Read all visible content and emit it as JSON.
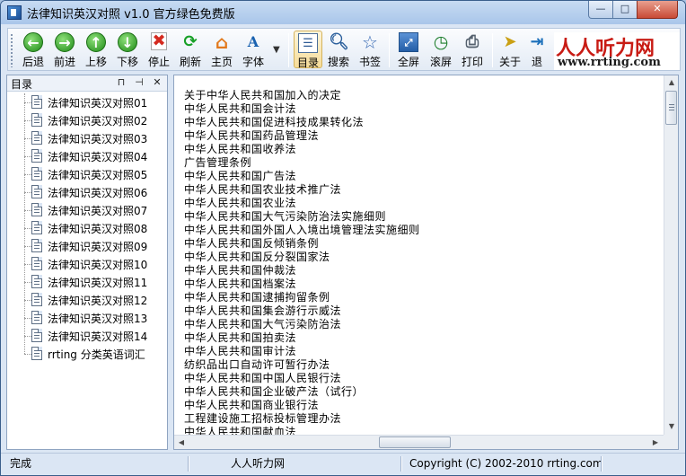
{
  "window": {
    "title": "法律知识英汉对照 v1.0 官方绿色免费版",
    "controls": {
      "minimize": "—",
      "maximize": "□",
      "close": "✕"
    }
  },
  "toolbar": {
    "buttons": [
      {
        "label": "后退",
        "icon": "back-arrow-icon",
        "glyph": "←"
      },
      {
        "label": "前进",
        "icon": "forward-arrow-icon",
        "glyph": "→"
      },
      {
        "label": "上移",
        "icon": "up-arrow-icon",
        "glyph": "↑"
      },
      {
        "label": "下移",
        "icon": "down-arrow-icon",
        "glyph": "↓"
      },
      {
        "label": "停止",
        "icon": "stop-icon",
        "glyph": "✖"
      },
      {
        "label": "刷新",
        "icon": "refresh-icon",
        "glyph": "⟳"
      },
      {
        "label": "主页",
        "icon": "home-icon",
        "glyph": "⌂"
      },
      {
        "label": "字体",
        "icon": "font-icon",
        "glyph": "A"
      },
      {
        "label": "目录",
        "icon": "directory-icon",
        "glyph": "☰"
      },
      {
        "label": "搜索",
        "icon": "search-icon",
        "glyph": "🔍︎"
      },
      {
        "label": "书签",
        "icon": "bookmark-star-icon",
        "glyph": "☆"
      },
      {
        "label": "全屏",
        "icon": "fullscreen-icon",
        "glyph": "⤢"
      },
      {
        "label": "滚屏",
        "icon": "auto-scroll-icon",
        "glyph": "◷"
      },
      {
        "label": "打印",
        "icon": "printer-icon",
        "glyph": "⎙"
      },
      {
        "label": "关于",
        "icon": "about-pointer-icon",
        "glyph": "➤"
      },
      {
        "label": "退",
        "icon": "exit-icon",
        "glyph": "⇥"
      }
    ],
    "dropdown_glyph": "▼"
  },
  "logo": {
    "cn": "人人听力网",
    "en": "www.rrting.com"
  },
  "sidebar": {
    "title": "目录",
    "pin_glyph": "⊓",
    "autohide_glyph": "⊣",
    "close_glyph": "✕",
    "items": [
      "法律知识英汉对照01",
      "法律知识英汉对照02",
      "法律知识英汉对照03",
      "法律知识英汉对照04",
      "法律知识英汉对照05",
      "法律知识英汉对照06",
      "法律知识英汉对照07",
      "法律知识英汉对照08",
      "法律知识英汉对照09",
      "法律知识英汉对照10",
      "法律知识英汉对照11",
      "法律知识英汉对照12",
      "法律知识英汉对照13",
      "法律知识英汉对照14",
      "rrting 分类英语词汇"
    ]
  },
  "content": {
    "items": [
      "关于中华人民共和国加入的决定",
      "中华人民共和国会计法",
      "中华人民共和国促进科技成果转化法",
      "中华人民共和国药品管理法",
      "中华人民共和国收养法",
      "广告管理条例",
      "中华人民共和国广告法",
      "中华人民共和国农业技术推广法",
      "中华人民共和国农业法",
      "中华人民共和国大气污染防治法实施细则",
      "中华人民共和国外国人入境出境管理法实施细则",
      "中华人民共和国反倾销条例",
      "中华人民共和国反分裂国家法",
      "中华人民共和国仲裁法",
      "中华人民共和国档案法",
      "中华人民共和国逮捕拘留条例",
      "中华人民共和国集会游行示威法",
      "中华人民共和国大气污染防治法",
      "中华人民共和国拍卖法",
      "中华人民共和国审计法",
      "纺织品出口自动许可暂行办法",
      "中华人民共和国中国人民银行法",
      "中华人民共和国企业破产法（试行）",
      "中华人民共和国商业银行法",
      "工程建设施工招标投标管理办法",
      "中华人民共和国献血法"
    ],
    "scroll_up": "▲",
    "scroll_down": "▼",
    "scroll_left": "◀",
    "scroll_right": "▶"
  },
  "statusbar": {
    "status": "完成",
    "site": "人人听力网",
    "copyright": "Copyright (C) 2002-2010 rrting.com"
  }
}
